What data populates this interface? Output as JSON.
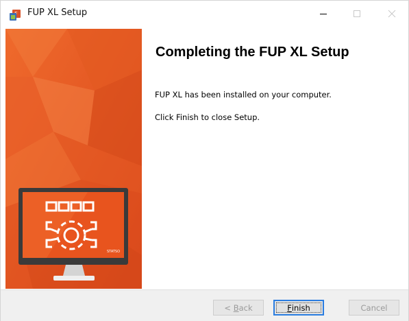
{
  "window": {
    "title": "FUP XL Setup",
    "icons": {
      "app": "setup-app-icon",
      "minimize": "minimize-icon",
      "maximize": "maximize-icon",
      "close": "close-icon"
    }
  },
  "banner": {
    "accent_color": "#e8541e",
    "monitor_brand_text": "STATSO"
  },
  "content": {
    "heading": "Completing the FUP XL Setup",
    "installed_text": "FUP XL has been installed on your computer.",
    "finish_text": "Click Finish to close Setup."
  },
  "buttons": {
    "back_prefix": "< ",
    "back_accel": "B",
    "back_rest": "ack",
    "finish_accel": "F",
    "finish_rest": "inish",
    "cancel_label": "Cancel"
  },
  "colors": {
    "focus_border": "#2a7de1",
    "disabled_text": "#9a9a9a"
  }
}
